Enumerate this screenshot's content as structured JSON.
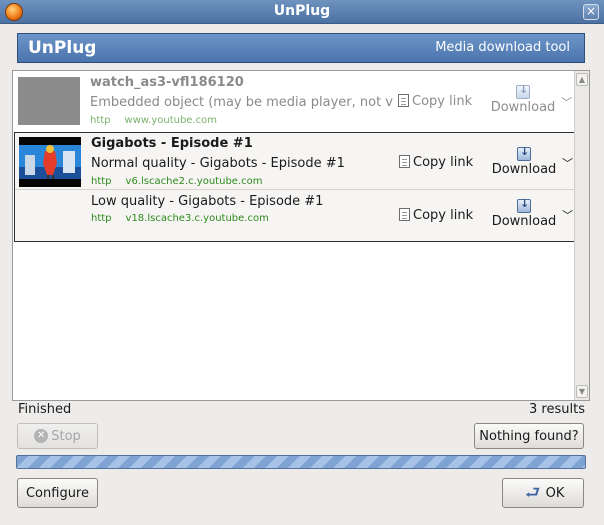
{
  "window": {
    "title": "UnPlug"
  },
  "banner": {
    "name": "UnPlug",
    "subtitle": "Media download tool"
  },
  "results": [
    {
      "title": "watch_as3-vfl186120",
      "enabled": false,
      "items": [
        {
          "description": "Embedded object (may be media player, not vi",
          "protocol": "http",
          "host": "www.youtube.com",
          "copy_label": "Copy link",
          "download_label": "Download"
        }
      ]
    },
    {
      "title": "Gigabots - Episode #1",
      "enabled": true,
      "items": [
        {
          "description": "Normal quality - Gigabots - Episode #1",
          "protocol": "http",
          "host": "v6.lscache2.c.youtube.com",
          "copy_label": "Copy link",
          "download_label": "Download"
        },
        {
          "description": "Low quality - Gigabots - Episode #1",
          "protocol": "http",
          "host": "v18.lscache3.c.youtube.com",
          "copy_label": "Copy link",
          "download_label": "Download"
        }
      ]
    }
  ],
  "status": {
    "text": "Finished",
    "count": "3 results"
  },
  "buttons": {
    "stop": "Stop",
    "nothing_found": "Nothing found?",
    "configure": "Configure",
    "ok": "OK"
  },
  "progress": 1.0,
  "icons": {
    "app": "firefox-icon",
    "close": "close-icon",
    "copy": "document-icon",
    "download": "download-icon",
    "dropdown": "chevron-down-icon",
    "stop": "stop-icon",
    "ok": "ok-arrow-icon"
  },
  "colors": {
    "banner": "#4a74ad",
    "url": "#2f8a1d",
    "progress": "#7fa3d2"
  }
}
